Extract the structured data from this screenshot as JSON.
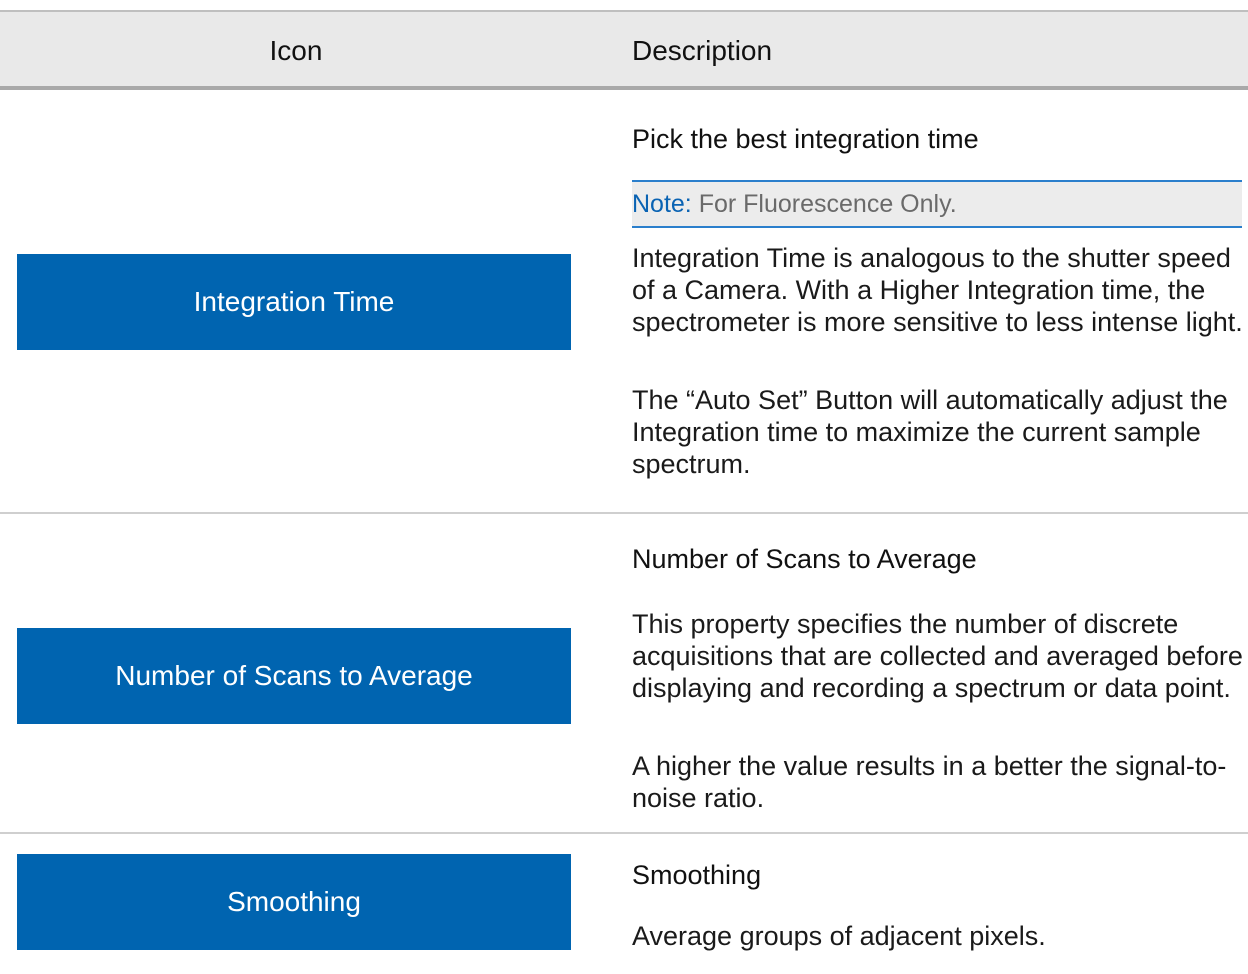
{
  "table": {
    "header": {
      "icon_col": "Icon",
      "desc_col": "Description"
    },
    "rows": [
      {
        "button_label": "Integration Time",
        "title": "Pick the best integration time",
        "note_label": "Note:",
        "note_text": "For Fluorescence Only.",
        "paragraphs": [
          "Integration Time is analogous to the shutter speed of a Camera. With a Higher Integ­ration time, the spectrometer is more sens­itive to less intense light.",
          "The “Auto Set” Button will automatically adjust the Integration time to maximize the current sample spectrum."
        ]
      },
      {
        "button_label": "Number of Scans to Average",
        "title": "Number of Scans to Average",
        "paragraphs": [
          "This property specifies the number of dis­crete acquisitions that are collected and averaged before displaying and recording a spectrum or data point.",
          "A higher the value results in a better the signal-to-noise ratio."
        ]
      },
      {
        "button_label": "Smoothing",
        "title": "Smoothing",
        "paragraphs": [
          "Average groups of adjacent pixels."
        ]
      }
    ]
  },
  "colors": {
    "button_bg": "#0064b0",
    "header_bg": "#e9e9e9",
    "note_label": "#0a63b3"
  }
}
